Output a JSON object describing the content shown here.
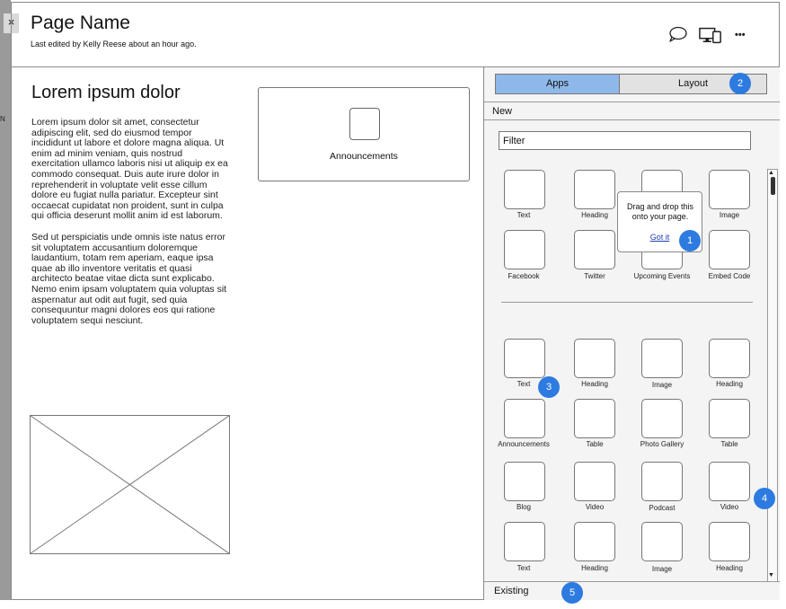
{
  "header": {
    "close_label": "×",
    "title": "Page Name",
    "subtitle": "Last edited by Kelly Reese about an hour ago.",
    "more_label": "•••"
  },
  "edge_letter": "N",
  "content": {
    "heading": "Lorem ipsum dolor",
    "paragraphs": [
      "Lorem ipsum dolor sit amet, consectetur adipiscing elit, sed do eiusmod tempor incididunt ut labore et dolore magna aliqua. Ut enim ad minim veniam, quis nostrud exercitation ullamco laboris nisi ut aliquip ex ea commodo consequat. Duis aute irure dolor in reprehenderit in voluptate velit esse cillum dolore eu fugiat nulla pariatur. Excepteur sint occaecat cupidatat non proident, sunt in culpa qui officia deserunt mollit anim id est laborum.",
      "Sed ut perspiciatis unde omnis iste natus error sit voluptatem accusantium doloremque laudantium, totam rem aperiam, eaque ipsa quae ab illo inventore veritatis et quasi architecto beatae vitae dicta sunt explicabo. Nemo enim ipsam voluptatem quia voluptas sit aspernatur aut odit aut fugit, sed quia consequuntur magni dolores eos qui ratione voluptatem sequi nesciunt."
    ],
    "announcements_label": "Announcements"
  },
  "panel": {
    "tabs": {
      "apps": "Apps",
      "layout": "Layout"
    },
    "new_label": "New",
    "filter_value": "Filter",
    "new_apps": [
      "Text",
      "Heading",
      "",
      "Image",
      "Facebook",
      "Twitter",
      "Upcoming Events",
      "Embed Code"
    ],
    "existing_apps": [
      "Text",
      "Heading",
      "Image",
      "Heading",
      "Announcements",
      "Table",
      "Photo Gallery",
      "Table",
      "Blog",
      "Video",
      "Podcast",
      "Video",
      "Text",
      "Heading",
      "Image",
      "Heading"
    ],
    "tooltip": {
      "text": "Drag and drop this onto your page.",
      "link": "Got it"
    },
    "existing_label": "Existing"
  },
  "badges": [
    "1",
    "2",
    "3",
    "4",
    "5"
  ],
  "colors": {
    "active_tab": "#8fb8ea",
    "badge": "#2d7be0"
  }
}
